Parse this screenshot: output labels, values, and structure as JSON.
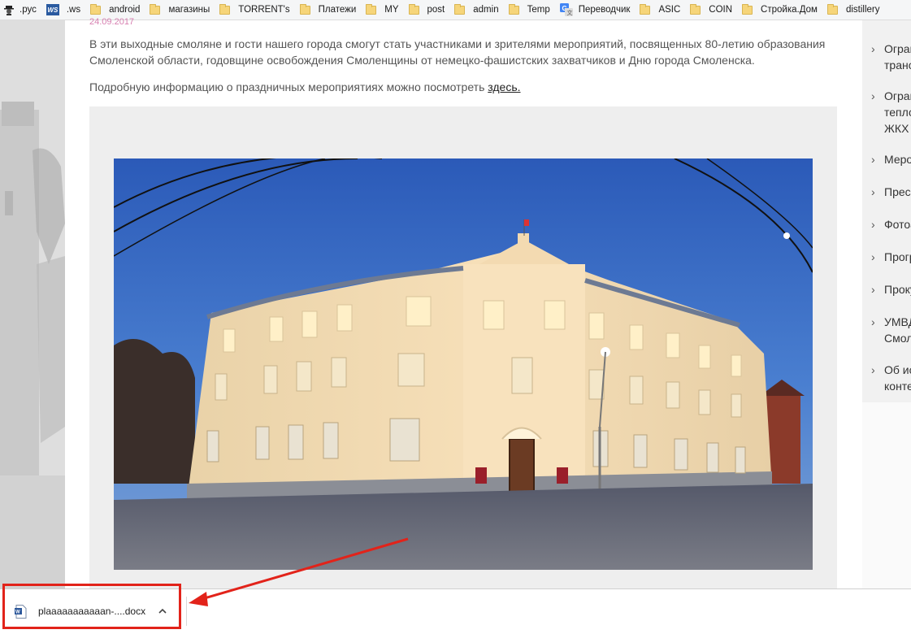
{
  "bookmarks": [
    {
      "label": ".рус",
      "icon": "spy-icon"
    },
    {
      "label": ".ws",
      "icon": "ws-icon"
    },
    {
      "label": "android",
      "icon": "folder-icon"
    },
    {
      "label": "магазины",
      "icon": "folder-icon"
    },
    {
      "label": "TORRENT's",
      "icon": "folder-icon"
    },
    {
      "label": "Платежи",
      "icon": "folder-icon"
    },
    {
      "label": "MY",
      "icon": "folder-icon"
    },
    {
      "label": "post",
      "icon": "folder-icon"
    },
    {
      "label": "admin",
      "icon": "folder-icon"
    },
    {
      "label": "Temp",
      "icon": "folder-icon"
    },
    {
      "label": "Переводчик",
      "icon": "google-translate-icon"
    },
    {
      "label": "ASIC",
      "icon": "folder-icon"
    },
    {
      "label": "COIN",
      "icon": "folder-icon"
    },
    {
      "label": "Стройка.Дом",
      "icon": "folder-icon"
    },
    {
      "label": "distillery",
      "icon": "folder-icon"
    }
  ],
  "article": {
    "date": "24.09.2017",
    "paragraph1": "В эти выходные смоляне и гости нашего города смогут стать участниками и зрителями мероприятий, посвященных 80-летию образования Смоленской области, годовщине освобождения Смоленщины от немецко-фашистских захватчиков и Дню города Смоленска.",
    "paragraph2_prefix": "Подробную информацию о праздничных мероприятиях можно посмотреть ",
    "paragraph2_link": "здесь."
  },
  "sidebar": {
    "items": [
      {
        "line1": "Ограничение",
        "line2": "транспорта"
      },
      {
        "line1": "Ограничение",
        "line2": "теплоснабжения",
        "line3": "ЖКХ"
      },
      {
        "line1": "Мероприятия"
      },
      {
        "line1": "Пресс-центр"
      },
      {
        "line1": "Фотоархив"
      },
      {
        "line1": "Программа"
      },
      {
        "line1": "Прокуратура"
      },
      {
        "line1": "УМВД",
        "line2": "Смоленск"
      },
      {
        "line1": "Об использовании",
        "line2": "контента"
      }
    ]
  },
  "downloads": {
    "file_name": "plaaaaaaaaaaan-....docx",
    "icon": "word-document-icon"
  },
  "colors": {
    "highlight": "#e2231a",
    "date": "#d77fb0",
    "sky": "#2f5db5"
  }
}
